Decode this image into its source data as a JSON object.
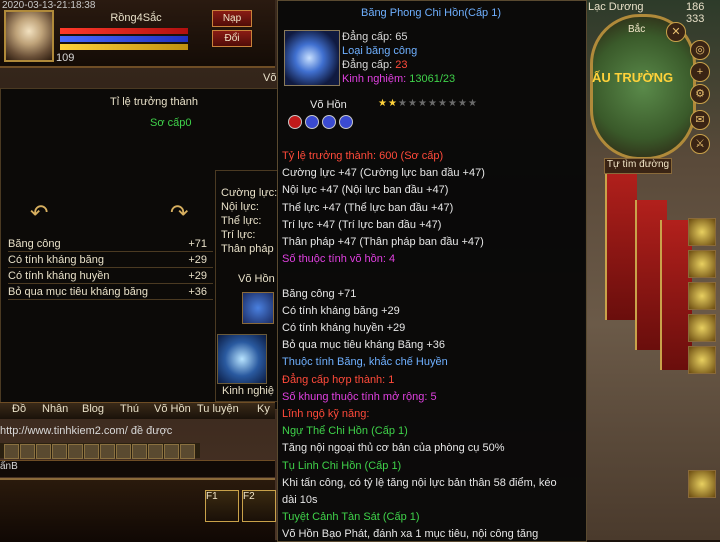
{
  "hud": {
    "datetime": "2020-03-13-21:18:38",
    "char_name": "Rồng4Sắc",
    "level": "109",
    "btn_nap": "Nạp",
    "btn_doi": "Đổi",
    "map_name": "Lạc Dương",
    "coord_x": "186",
    "coord_y": "333",
    "auto_route": "Tự tìm đường",
    "map_label": "Bắc",
    "map_banner": "ẤU TRƯỜNG"
  },
  "soul_panel": {
    "growth_label": "Tỉ lệ trưởng thành",
    "growth_value": "Sơ cấp0",
    "stats": [
      {
        "name": "Băng công",
        "value": "+71"
      },
      {
        "name": "Có tính kháng băng",
        "value": "+29"
      },
      {
        "name": "Có tính kháng huyền",
        "value": "+29"
      },
      {
        "name": "Bỏ qua mục tiêu kháng băng",
        "value": "+36"
      }
    ],
    "mid_labels": [
      "Cường lực:",
      "Nội lực:",
      "Thể lực:",
      "Trí lực:",
      "Thân pháp"
    ],
    "mid_soul": "Võ Hồn",
    "mid_exp": "Kinh nghiệ",
    "header_fragment": "Võ"
  },
  "tabs": [
    "Đồ",
    "Nhân",
    "Blog",
    "Thú",
    "Võ Hồn",
    "Tu luyện",
    "Ky"
  ],
  "chat": {
    "url": "http://www.tinhkiem2.com/ đề được",
    "input": "ấnB"
  },
  "skillbar": {
    "f1": "F1",
    "f2": "F2"
  },
  "tooltip": {
    "title": "Băng Phong Chi Hồn(Cấp 1)",
    "info": [
      {
        "text": "Đẳng cấp: 65",
        "color": "#d8d8d8"
      },
      {
        "text": "Loại băng công",
        "color": "#6fb0ff"
      },
      {
        "text": "Đẳng cấp: ",
        "value": "23",
        "color": "#d8d8d8",
        "value_color": "#ff4a3a"
      },
      {
        "text": "Kinh nghiệm: ",
        "value": "13061/23",
        "color": "#e040e0",
        "value_color": "#3fd24a"
      }
    ],
    "soul_label": "Võ Hồn",
    "stars_filled": 2,
    "stars_total": 10,
    "lines": [
      {
        "text": "Tỷ lệ trưởng thành: 600 (Sơ cấp)",
        "color": "#ff4a3a"
      },
      {
        "text": "Cường lực +47 (Cường lực ban đầu +47)",
        "color": "#e6e6e6"
      },
      {
        "text": "Nội lực +47 (Nội lực ban đầu +47)",
        "color": "#e6e6e6"
      },
      {
        "text": "Thể lực +47 (Thể lực ban đầu +47)",
        "color": "#e6e6e6"
      },
      {
        "text": "Trí lực +47 (Trí lực ban đầu +47)",
        "color": "#e6e6e6"
      },
      {
        "text": "Thân pháp +47 (Thân pháp ban đầu +47)",
        "color": "#e6e6e6"
      },
      {
        "text": "Số thuộc tính võ hồn: 4",
        "color": "#e040e0"
      },
      {
        "text": "",
        "color": "#e6e6e6"
      },
      {
        "text": "Băng công +71",
        "color": "#e6e6e6"
      },
      {
        "text": "Có tính kháng băng +29",
        "color": "#e6e6e6"
      },
      {
        "text": "Có tính kháng huyền +29",
        "color": "#e6e6e6"
      },
      {
        "text": "Bỏ qua mục tiêu kháng Băng  +36",
        "color": "#e6e6e6"
      },
      {
        "text": "Thuộc tính Băng, khắc chế Huyền",
        "color": "#6fb0ff"
      },
      {
        "text": "Đẳng cấp hợp thành: 1",
        "color": "#ff4a3a"
      },
      {
        "text": "Số khung thuộc tính mở rộng: 5",
        "color": "#e040e0"
      },
      {
        "text": "Lĩnh ngộ kỹ năng:",
        "color": "#ff4a3a"
      },
      {
        "text": "Ngự Thể Chi Hồn (Cấp 1)",
        "color": "#3fd24a"
      },
      {
        "text": "Tăng nội ngoại thủ cơ bản của phòng cụ 50%",
        "color": "#e6e6e6"
      },
      {
        "text": "Tụ Linh Chi Hồn (Cấp 1)",
        "color": "#3fd24a"
      },
      {
        "text": "Khi tấn công, có tỷ lệ tăng nội lực bản thân 58 điểm, kéo",
        "color": "#e6e6e6"
      },
      {
        "text": " dài 10s",
        "color": "#e6e6e6"
      },
      {
        "text": "Tuyệt Cảnh Tàn Sát (Cấp 1)",
        "color": "#3fd24a"
      },
      {
        "text": "Võ Hồn Bạo Phát, đánh xa 1 mục tiêu, nội công tăng",
        "color": "#e6e6e6"
      }
    ]
  },
  "colors": {
    "accent_gold": "#c9a24a",
    "green": "#3fd24a",
    "red": "#ff4a3a",
    "blue": "#6fb0ff",
    "magenta": "#e040e0"
  }
}
